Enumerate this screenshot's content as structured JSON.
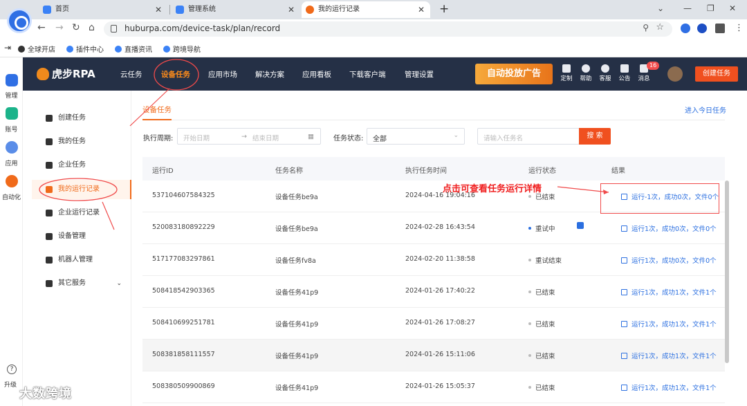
{
  "browser": {
    "tabs": [
      {
        "title": "首页",
        "active": false
      },
      {
        "title": "管理系统",
        "active": false
      },
      {
        "title": "我的运行记录",
        "active": true
      }
    ],
    "url": "huburpa.com/device-task/plan/record",
    "bookmarks": [
      "全球开店",
      "插件中心",
      "直播资讯",
      "跨境导航"
    ]
  },
  "left_rail": {
    "items": [
      {
        "label": "管理",
        "color": "#2f6fe4"
      },
      {
        "label": "账号",
        "color": "#1bb38a"
      },
      {
        "label": "应用",
        "color": "#5a8de8"
      },
      {
        "label": "自动化",
        "color": "#f06a1a"
      }
    ],
    "upgrade_label": "升级"
  },
  "topnav": {
    "logo": "虎步RPA",
    "items": [
      "云任务",
      "设备任务",
      "应用市场",
      "解决方案",
      "应用看板",
      "下载客户端",
      "管理设置"
    ],
    "active_index": 1,
    "banner": "自动投放广告",
    "icons": [
      {
        "name": "customize-icon",
        "label": "定制"
      },
      {
        "name": "help-icon",
        "label": "帮助"
      },
      {
        "name": "service-icon",
        "label": "客服"
      },
      {
        "name": "notice-icon",
        "label": "公告"
      },
      {
        "name": "bell-icon",
        "label": "消息"
      }
    ],
    "message_count": "16",
    "create_button": "创建任务"
  },
  "sidebar": {
    "items": [
      {
        "label": "创建任务",
        "active": false
      },
      {
        "label": "我的任务",
        "active": false
      },
      {
        "label": "企业任务",
        "active": false
      },
      {
        "label": "我的运行记录",
        "active": true
      },
      {
        "label": "企业运行记录",
        "active": false
      },
      {
        "label": "设备管理",
        "active": false
      },
      {
        "label": "机器人管理",
        "active": false
      },
      {
        "label": "其它服务",
        "active": false
      }
    ]
  },
  "main": {
    "breadcrumb": "设备任务",
    "today_link": "进入今日任务",
    "filters": {
      "period_label": "执行周期:",
      "start_placeholder": "开始日期",
      "end_placeholder": "结束日期",
      "status_label": "任务状态:",
      "status_value": "全部",
      "name_placeholder": "请输入任务名",
      "search_button": "搜 索"
    },
    "table": {
      "headers": [
        "运行ID",
        "任务名称",
        "执行任务时间",
        "运行状态",
        "结果"
      ],
      "rows": [
        {
          "id": "537104607584325",
          "name": "设备任务be9a",
          "time": "2024-04-16 19:04:16",
          "status": "已结束",
          "result": "运行-1次，成功0次，文件0个"
        },
        {
          "id": "520083180892229",
          "name": "设备任务be9a",
          "time": "2024-02-28 16:43:54",
          "status": "重试中",
          "result": "运行1次，成功0次，文件0个"
        },
        {
          "id": "517177083297861",
          "name": "设备任务fv8a",
          "time": "2024-02-20 11:38:58",
          "status": "重试结束",
          "result": "运行1次，成功0次，文件0个"
        },
        {
          "id": "508418542903365",
          "name": "设备任务41p9",
          "time": "2024-01-26 17:40:22",
          "status": "已结束",
          "result": "运行1次，成功1次，文件1个"
        },
        {
          "id": "508410699251781",
          "name": "设备任务41p9",
          "time": "2024-01-26 17:08:27",
          "status": "已结束",
          "result": "运行1次，成功1次，文件1个"
        },
        {
          "id": "508381858111557",
          "name": "设备任务41p9",
          "time": "2024-01-26 15:11:06",
          "status": "已结束",
          "result": "运行1次，成功1次，文件1个"
        },
        {
          "id": "508380509900869",
          "name": "设备任务41p9",
          "time": "2024-01-26 15:05:37",
          "status": "已结束",
          "result": "运行1次，成功1次，文件1个"
        }
      ]
    }
  },
  "annotation": {
    "text": "点击可查看任务运行详情",
    "color": "#f01e1e"
  },
  "watermark": "大数跨境"
}
